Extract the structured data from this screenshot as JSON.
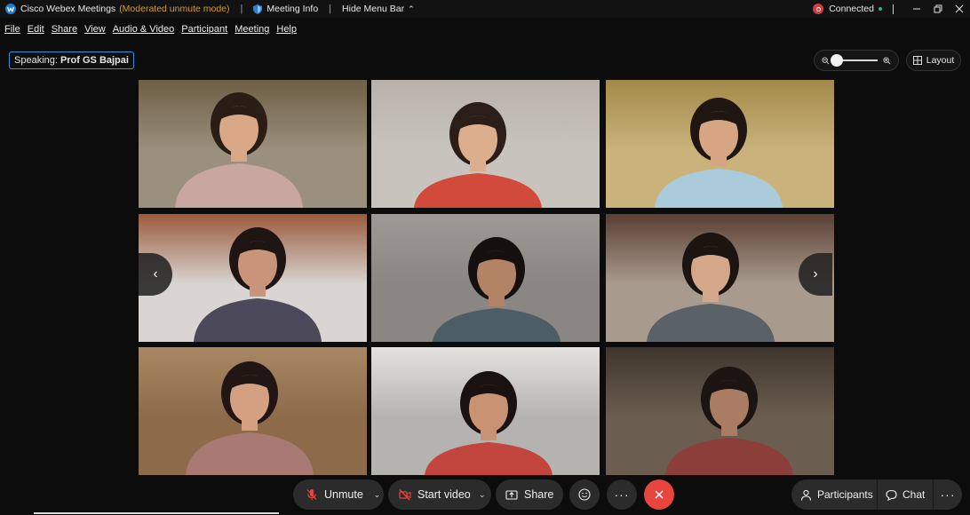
{
  "titlebar": {
    "app_name": "Cisco Webex Meetings",
    "mode": "(Moderated unmute mode)",
    "meeting_info": "Meeting Info",
    "hide_menu_bar": "Hide Menu Bar",
    "status": "Connected"
  },
  "menu": [
    "File",
    "Edit",
    "Share",
    "View",
    "Audio & Video",
    "Participant",
    "Meeting",
    "Help"
  ],
  "speaking": {
    "prefix": "Speaking:",
    "name": "Prof GS Bajpai"
  },
  "zoom": {
    "level": 0.05
  },
  "layout_label": "Layout",
  "controls": {
    "unmute": "Unmute",
    "start_video": "Start video",
    "share": "Share",
    "participants": "Participants",
    "chat": "Chat"
  },
  "colors": {
    "accent_blue": "#3a8fd8",
    "mode_orange": "#d79b2e",
    "leave_red": "#e8453c",
    "mute_red": "#e8453c",
    "connected_green": "#36b37e"
  },
  "tiles": [
    {
      "bg": "#9b8f7d",
      "top": "#6e5f45",
      "shirt": "#c9a6a0",
      "hair": "#2a1d16",
      "skin": "#d8a887"
    },
    {
      "bg": "#c9c3be",
      "top": "#b8b1ac",
      "shirt": "#d24a3b",
      "hair": "#2b1e18",
      "skin": "#dcae8e"
    },
    {
      "bg": "#c9b37a",
      "top": "#a38a4a",
      "shirt": "#a9cbdc",
      "hair": "#1f1612",
      "skin": "#d6a583"
    },
    {
      "bg": "#d8d5d2",
      "top": "#9a5a3b",
      "shirt": "#4c4a5a",
      "hair": "#1e1513",
      "skin": "#c8947a"
    },
    {
      "bg": "#8a8682",
      "top": "#9d9994",
      "shirt": "#4d5d66",
      "hair": "#141010",
      "skin": "#b38365"
    },
    {
      "bg": "#a89b8e",
      "top": "#5a3f33",
      "shirt": "#5a6167",
      "hair": "#1b1411",
      "skin": "#d4a78a"
    },
    {
      "bg": "#8d6a4a",
      "top": "#a98764",
      "shirt": "#a87a73",
      "hair": "#211613",
      "skin": "#d3a181"
    },
    {
      "bg": "#b4b3af",
      "top": "#e4e2de",
      "shirt": "#c2453e",
      "hair": "#1a1210",
      "skin": "#c99272"
    },
    {
      "bg": "#6b5e50",
      "top": "#3f352c",
      "shirt": "#8c3e3a",
      "hair": "#1b1411",
      "skin": "#a97c63"
    }
  ]
}
